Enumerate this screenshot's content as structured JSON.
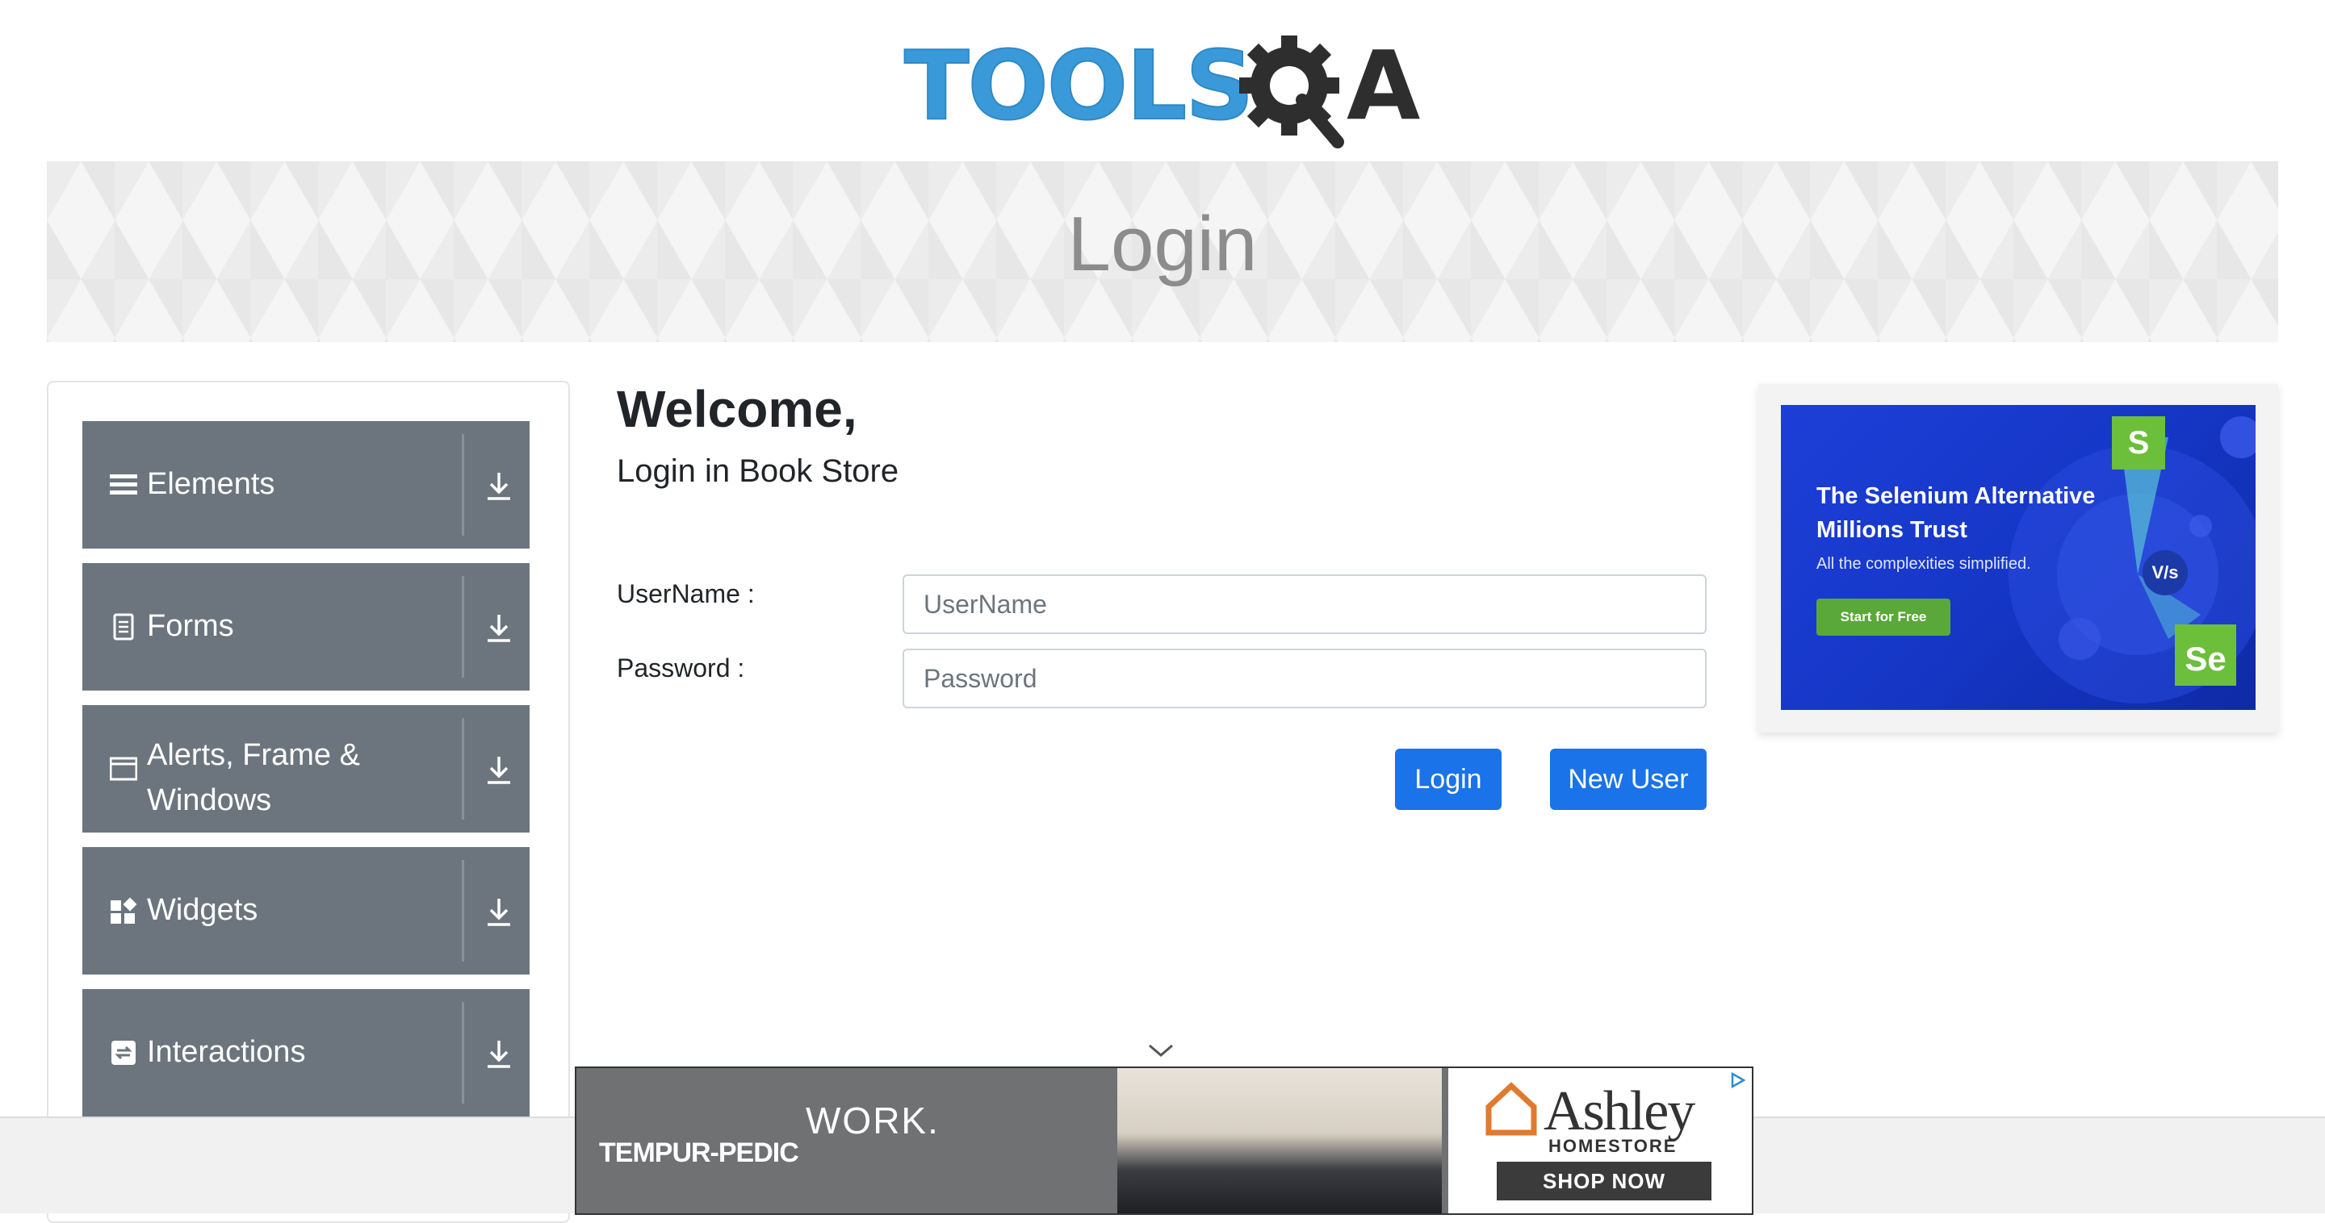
{
  "header": {
    "logo_text": "TOOLS",
    "logo_suffix": "A"
  },
  "banner": {
    "title": "Login"
  },
  "sidebar": {
    "groups": [
      {
        "label": "Elements",
        "icon": "hamburger-icon"
      },
      {
        "label": "Forms",
        "icon": "document-icon"
      },
      {
        "label": "Alerts, Frame & Windows",
        "icon": "window-icon"
      },
      {
        "label": "Widgets",
        "icon": "widgets-icon"
      },
      {
        "label": "Interactions",
        "icon": "interactions-icon"
      }
    ]
  },
  "main": {
    "heading": "Welcome,",
    "subheading": "Login in Book Store",
    "username": {
      "label": "UserName :",
      "placeholder": "UserName",
      "value": ""
    },
    "password": {
      "label": "Password :",
      "placeholder": "Password",
      "value": ""
    },
    "login_button": "Login",
    "new_user_button": "New User"
  },
  "side_ad": {
    "title_line1": "The Selenium Alternative",
    "title_line2": "Millions Trust",
    "subtitle": "All the complexities simplified.",
    "cta": "Start for Free",
    "badge_s": "S",
    "badge_vs": "V/s",
    "badge_se": "Se"
  },
  "bottom_ad": {
    "brand": "TEMPUR-PEDIC",
    "tagline": "WORK.",
    "store_name": "Ashley",
    "store_sub": "HOMESTORE",
    "cta": "SHOP NOW"
  },
  "colors": {
    "sidebar_group": "#6c757d",
    "primary_button": "#1a73e8",
    "logo_blue": "#3a9ad9",
    "ad_blue": "#1d3fd8",
    "ad_green": "#5aa83a"
  }
}
